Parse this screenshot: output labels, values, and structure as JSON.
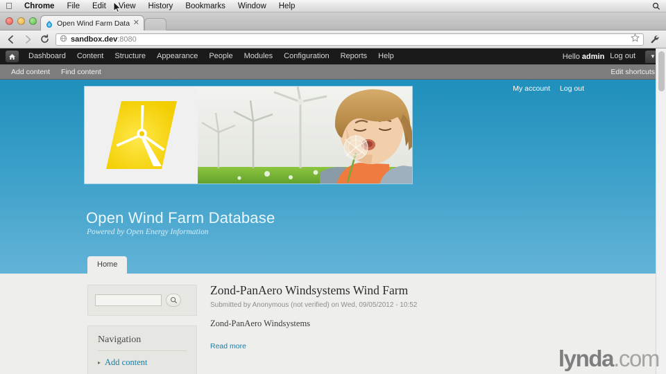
{
  "os_menubar": {
    "apple_icon": "apple-logo-icon",
    "items": [
      {
        "label": "Chrome",
        "bold": true
      },
      {
        "label": "File",
        "bold": false
      },
      {
        "label": "Edit",
        "bold": false
      },
      {
        "label": "View",
        "bold": false
      },
      {
        "label": "History",
        "bold": false
      },
      {
        "label": "Bookmarks",
        "bold": false
      },
      {
        "label": "Window",
        "bold": false
      },
      {
        "label": "Help",
        "bold": false
      }
    ],
    "spotlight_icon": "search-icon"
  },
  "browser": {
    "tab": {
      "title": "Open Wind Farm Database |",
      "favicon": "drupal-droplet-icon",
      "close_icon": "close-icon"
    },
    "back_icon": "back-arrow-icon",
    "forward_icon": "forward-arrow-icon",
    "reload_icon": "reload-icon",
    "url_prefix": "sandbox.dev",
    "url_suffix": ":8080",
    "page_info_icon": "globe-icon",
    "bookmark_icon": "star-icon",
    "menu_icon": "wrench-icon"
  },
  "drupal_toolbar": {
    "home_icon": "home-icon",
    "items": [
      {
        "label": "Dashboard"
      },
      {
        "label": "Content"
      },
      {
        "label": "Structure"
      },
      {
        "label": "Appearance"
      },
      {
        "label": "People"
      },
      {
        "label": "Modules"
      },
      {
        "label": "Configuration"
      },
      {
        "label": "Reports"
      },
      {
        "label": "Help"
      }
    ],
    "greeting_prefix": "Hello ",
    "greeting_user": "admin",
    "logout_label": "Log out",
    "toggle_icon": "chevron-down-icon"
  },
  "shortcut_bar": {
    "items": [
      {
        "label": "Add content"
      },
      {
        "label": "Find content"
      }
    ],
    "edit_label": "Edit shortcuts"
  },
  "user_links": {
    "my_account_label": "My account",
    "logout_label": "Log out"
  },
  "site": {
    "title": "Open Wind Farm Database",
    "slogan": "Powered by Open Energy Information",
    "hero_logo_alt": "wind-turbine-logo",
    "hero_photo_alt": "child-blowing-dandelion-with-wind-turbines"
  },
  "primary_tabs": [
    {
      "label": "Home",
      "active": true
    }
  ],
  "sidebar": {
    "search": {
      "value": "",
      "placeholder": "",
      "button_icon": "search-icon"
    },
    "navigation": {
      "heading": "Navigation",
      "items": [
        {
          "label": "Add content",
          "bullet": "▸"
        }
      ]
    }
  },
  "node": {
    "title": "Zond-PanAero Windsystems Wind Farm",
    "submitted": "Submitted by Anonymous (not verified) on Wed, 09/05/2012 - 10:52",
    "body": "Zond-PanAero Windsystems",
    "read_more_label": "Read more"
  },
  "watermark": {
    "brand": "lynda",
    "tld": ".com"
  },
  "colors": {
    "banner_top": "#1f8fbb",
    "banner_bottom": "#63b3d8",
    "link": "#1f7ba3",
    "toolbar_bg": "#1a1a1a",
    "shortcut_bg": "#7d7d7d",
    "content_bg": "#eeeeec",
    "logo_yellow": "#f2cd00"
  }
}
